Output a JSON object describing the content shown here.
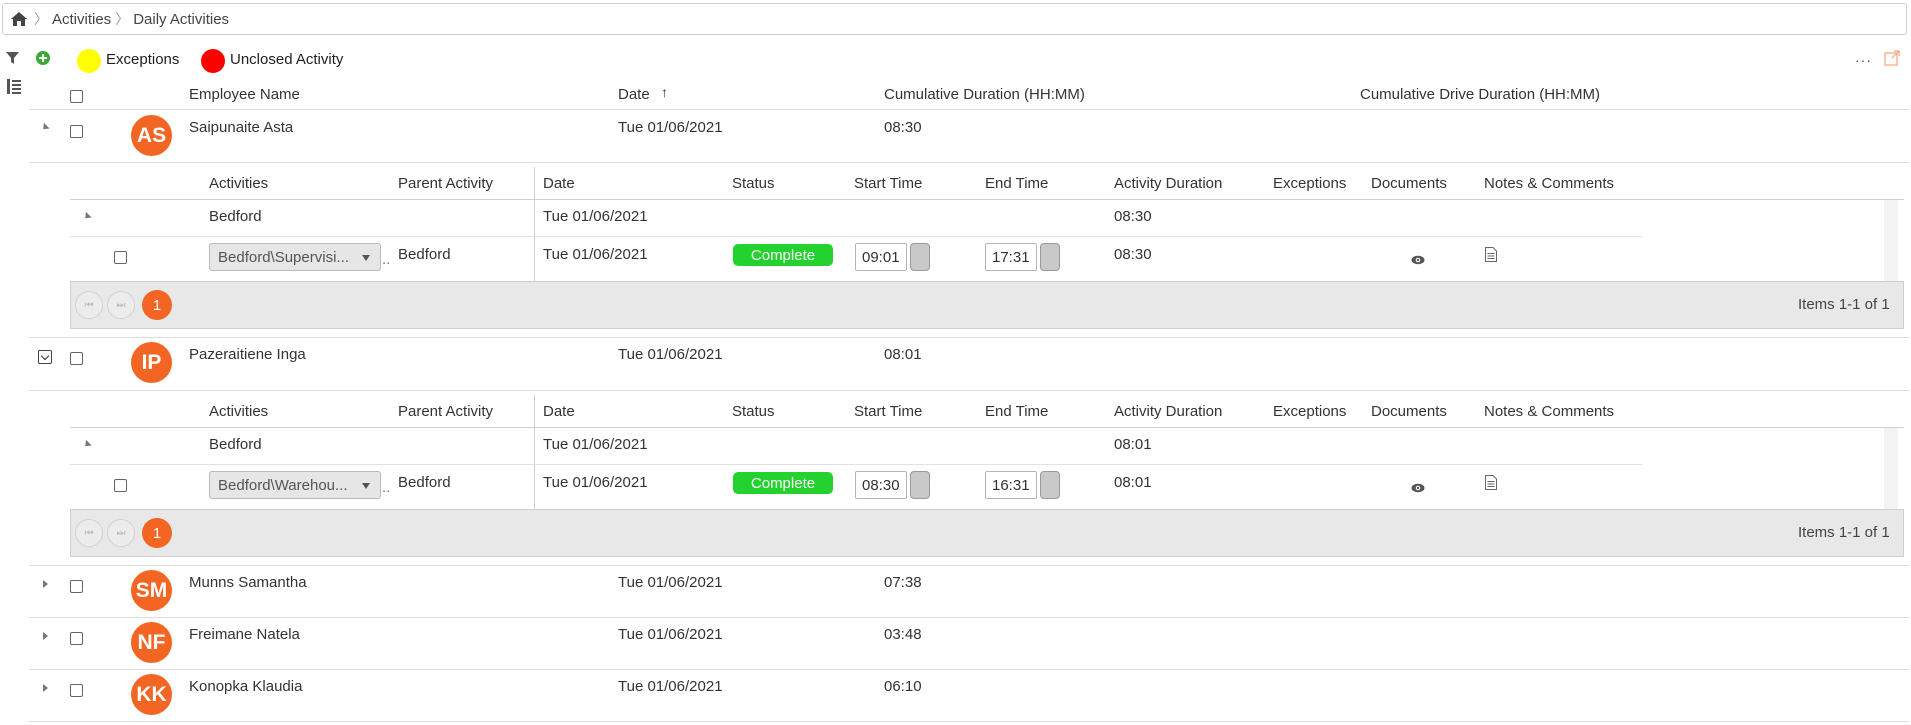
{
  "breadcrumb": {
    "home_icon": "home-icon",
    "items": [
      "Activities",
      "Daily Activities"
    ]
  },
  "toolbar": {
    "filter_icon": "filter-icon",
    "add_icon": "add-circle-icon",
    "layout_icon": "columns-icon",
    "more_icon": "more-icon",
    "export_icon": "export-icon",
    "legend": [
      {
        "label": "Exceptions",
        "color": "#ffff00"
      },
      {
        "label": "Unclosed Activity",
        "color": "#ff0000"
      }
    ]
  },
  "columns": {
    "employee": "Employee Name",
    "date": "Date",
    "date_sort": "↑",
    "cumulative": "Cumulative Duration (HH:MM)",
    "drive": "Cumulative Drive Duration (HH:MM)"
  },
  "inner_columns": [
    "Activities",
    "Parent Activity",
    "Date",
    "Status",
    "Start Time",
    "End Time",
    "Activity Duration",
    "Exceptions",
    "Documents",
    "Notes & Comments"
  ],
  "colors": {
    "accent": "#f26522",
    "status_complete": "#23d12f"
  },
  "employees": [
    {
      "initials": "AS",
      "name": "Saipunaite Asta",
      "date": "Tue 01/06/2021",
      "duration": "08:30",
      "expanded": true,
      "group": {
        "name": "Bedford",
        "date": "Tue 01/06/2021",
        "duration": "08:30"
      },
      "activity": {
        "activity": "Bedford\\Supervisi...",
        "parent": "Bedford",
        "date": "Tue 01/06/2021",
        "status": "Complete",
        "start": "09:01",
        "end": "17:31",
        "duration": "08:30"
      },
      "pager": {
        "page": "1",
        "info": "Items 1-1 of 1"
      }
    },
    {
      "initials": "IP",
      "name": "Pazeraitiene Inga",
      "date": "Tue 01/06/2021",
      "duration": "08:01",
      "expanded": true,
      "group": {
        "name": "Bedford",
        "date": "Tue 01/06/2021",
        "duration": "08:01"
      },
      "activity": {
        "activity": "Bedford\\Warehou...",
        "parent": "Bedford",
        "date": "Tue 01/06/2021",
        "status": "Complete",
        "start": "08:30",
        "end": "16:31",
        "duration": "08:01"
      },
      "pager": {
        "page": "1",
        "info": "Items 1-1 of 1"
      }
    },
    {
      "initials": "SM",
      "name": "Munns Samantha",
      "date": "Tue 01/06/2021",
      "duration": "07:38",
      "expanded": false
    },
    {
      "initials": "NF",
      "name": "Freimane Natela",
      "date": "Tue 01/06/2021",
      "duration": "03:48",
      "expanded": false
    },
    {
      "initials": "KK",
      "name": "Konopka Klaudia",
      "date": "Tue 01/06/2021",
      "duration": "06:10",
      "expanded": false
    }
  ]
}
